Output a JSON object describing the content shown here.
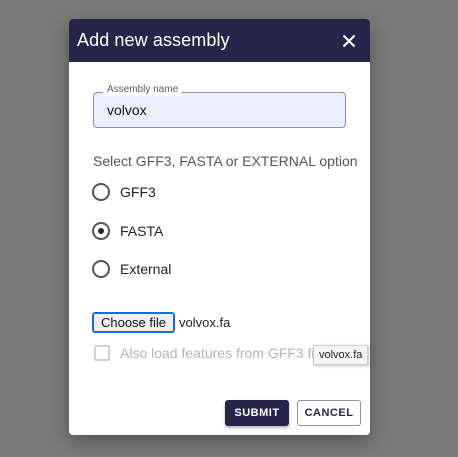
{
  "colors": {
    "header_bg": "#272449",
    "backdrop": "#7b7b7b",
    "input_bg": "#e9effd"
  },
  "dialog": {
    "title": "Add new assembly",
    "close_icon": "close-icon"
  },
  "assembly_name": {
    "label": "Assembly name",
    "value": "volvox"
  },
  "option_prompt": "Select GFF3, FASTA or EXTERNAL option",
  "options": [
    {
      "label": "GFF3",
      "selected": false
    },
    {
      "label": "FASTA",
      "selected": true
    },
    {
      "label": "External",
      "selected": false
    }
  ],
  "file_input": {
    "button_label": "Choose file",
    "file_name": "volvox.fa"
  },
  "load_features": {
    "label": "Also load features from GFF3 fi",
    "checked": false,
    "disabled": true
  },
  "buttons": {
    "submit": "SUBMIT",
    "cancel": "CANCEL"
  },
  "tooltip": "volvox.fa"
}
